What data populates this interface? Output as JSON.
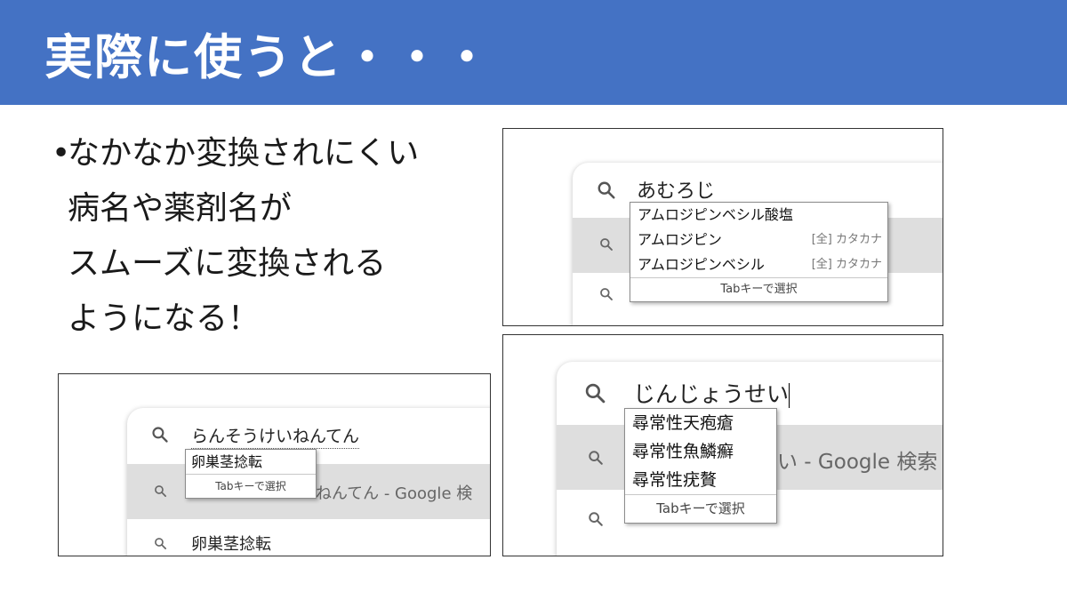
{
  "title": "実際に使うと・・・",
  "bullets": {
    "line1": "なかなか変換されにくい",
    "line2": "病名や薬剤名が",
    "line3": "スムーズに変換される",
    "line4": "ようになる！"
  },
  "shot1": {
    "query": "あむろじ",
    "candidates": [
      "アムロジピンベシル酸塩",
      "アムロジピン",
      "アムロジピンベシル"
    ],
    "hint": "[全] カタカナ",
    "tab_label": "Tabキーで選択"
  },
  "shot2": {
    "query": "らんそうけいねんてん",
    "candidate": "卵巣茎捻転",
    "tab_label": "Tabキーで選択",
    "row2_text": "ねんてん - Google 検",
    "row3_text": "卵巣茎捻転"
  },
  "shot3": {
    "query": "じんじょうせい",
    "candidates": [
      "尋常性天疱瘡",
      "尋常性魚鱗癬",
      "尋常性疣贅"
    ],
    "tab_label": "Tabキーで選択",
    "row2_text": "い - Google 検索"
  }
}
